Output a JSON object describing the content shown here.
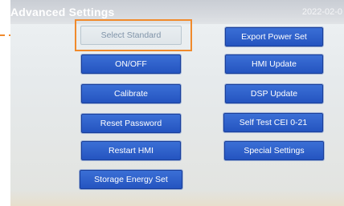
{
  "header": {
    "title": "Advanced Settings",
    "date": "2022-02-0"
  },
  "buttons_left": [
    {
      "label": "Select Standard"
    },
    {
      "label": "ON/OFF"
    },
    {
      "label": "Calibrate"
    },
    {
      "label": "Reset Password"
    },
    {
      "label": "Restart HMI"
    },
    {
      "label": "Storage Energy Set"
    }
  ],
  "buttons_right": [
    {
      "label": "Export Power Set"
    },
    {
      "label": "HMI Update"
    },
    {
      "label": "DSP Update"
    },
    {
      "label": "Self Test CEI 0-21"
    },
    {
      "label": "Special Settings"
    }
  ],
  "colors": {
    "highlight": "#f08a2c",
    "button_blue": "#2454c0",
    "selected_button_text": "#7f93a8"
  },
  "annotation": {
    "icon": "dashed-arrow-right-icon"
  }
}
